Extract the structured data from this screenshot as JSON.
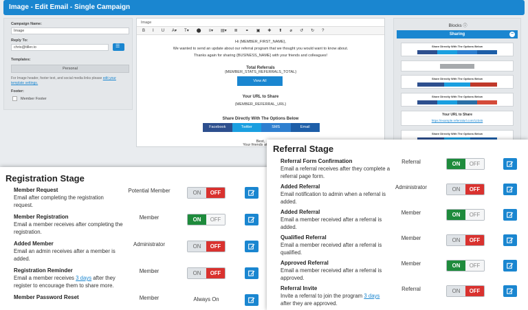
{
  "editor": {
    "header_title": "Image - Edit Email - Single Campaign",
    "left": {
      "campaign_name_label": "Campaign Name:",
      "campaign_name_value": "Image",
      "reply_to_label": "Reply To:",
      "reply_to_value": "chris@tiller.io",
      "templates_label": "Templates:",
      "template_value": "Personal",
      "help_text": "For Image header, footer text, and social media links please",
      "help_link": "edit your template settings.",
      "footer_label": "Footer:",
      "footer_option": "Member Footer"
    },
    "center": {
      "top_field": "Image",
      "toolbar": [
        "B",
        "I",
        "U",
        "A▾",
        "T▾",
        "⬤",
        "≡▾",
        "▤▾",
        "≣",
        "⚭",
        "▣",
        "✚",
        "⬆",
        "⌀",
        "↺",
        "↻",
        "?"
      ],
      "line_greeting": "Hi {MEMBER_FIRST_NAME},",
      "line_update": "We wanted to send an update about our referral program that we thought you would want to know about.",
      "line_thanks": "Thanks again for sharing {BUSINESS_NAME} with your friends and colleagues!",
      "total_referrals_title": "Total Referrals",
      "total_referrals_var": "{MEMBER_STATS_REFERRALS_TOTAL}",
      "view_all": "View All",
      "url_title": "Your URL to Share",
      "url_var": "{MEMBER_REFERRAL_URL}",
      "share_title": "Share Directly With The Options Below",
      "share_buttons": [
        "Facebook",
        "Twitter",
        "SMS",
        "Email"
      ],
      "best": "Best,",
      "your_friends": "Your friends at {BUSI"
    },
    "blocks": {
      "title": "Blocks",
      "sharing_label": "Sharing",
      "block1_title": "Share Directly With The Options Below",
      "block1_buttons": [
        "Facebook",
        "Twitter",
        "SMS",
        "Email"
      ],
      "block3_title": "Share Directly With The Options Below",
      "block3_buttons": [
        "Facebook",
        "Twitter",
        "Instagram"
      ],
      "block4_title": "Share Directly With The Options Below",
      "block4_buttons": [
        "Facebook",
        "Twitter",
        "LinkedIn",
        "Google+"
      ],
      "block5_title": "Your URL to Share",
      "block5_link": "https://example.referralurl.com/12345",
      "block6_title": "Share Directly With The Options Below"
    }
  },
  "registration": {
    "title": "Registration Stage",
    "rows": [
      {
        "title": "Member Request",
        "desc": "Email after completing the registration request.",
        "recipient": "Potential Member",
        "state": "off"
      },
      {
        "title": "Member Registration",
        "desc": "Email a member receives after completing the registration.",
        "recipient": "Member",
        "state": "on"
      },
      {
        "title": "Added Member",
        "desc": "Email an admin receives after a member is added.",
        "recipient": "Administrator",
        "state": "off"
      },
      {
        "title": "Registration Reminder",
        "desc_pre": "Email a member receives",
        "desc_link": "3 days",
        "desc_post": "after they register to encourage them to share more.",
        "recipient": "Member",
        "state": "off"
      },
      {
        "title": "Member Password Reset",
        "desc": "",
        "recipient": "Member",
        "state": "always",
        "always_text": "Always On"
      }
    ]
  },
  "referral": {
    "title": "Referral Stage",
    "rows": [
      {
        "title": "Referral Form Confirmation",
        "desc": "Email a referral receives after they complete a referral page form.",
        "recipient": "Referral",
        "state": "on"
      },
      {
        "title": "Added Referral",
        "desc": "Email notification to admin when a referral is added.",
        "recipient": "Administrator",
        "state": "off"
      },
      {
        "title": "Added Referral",
        "desc": "Email a member received after a referral is added.",
        "recipient": "Member",
        "state": "on"
      },
      {
        "title": "Qualified Referral",
        "desc": "Email a member received after a referral is qualified.",
        "recipient": "Member",
        "state": "off"
      },
      {
        "title": "Approved Referral",
        "desc": "Email a member received after a referral is approved.",
        "recipient": "Member",
        "state": "on"
      },
      {
        "title": "Referral Invite",
        "desc_pre": "Invite a referral to join the program",
        "desc_link": "3 days",
        "desc_post": "after they are approved.",
        "recipient": "Referral",
        "state": "off"
      }
    ]
  },
  "toggle_labels": {
    "on": "ON",
    "off": "OFF"
  },
  "colors": {
    "primary": "#1a86d0",
    "on_green": "#1e8b3c",
    "off_red": "#d9322f",
    "facebook": "#2d4f8e",
    "twitter": "#1a9fe0",
    "sms": "#2e7fd0",
    "email": "#1d5ea8",
    "instagram": "#c0392b",
    "linkedin": "#2a6fa6",
    "google": "#d44b3a"
  }
}
